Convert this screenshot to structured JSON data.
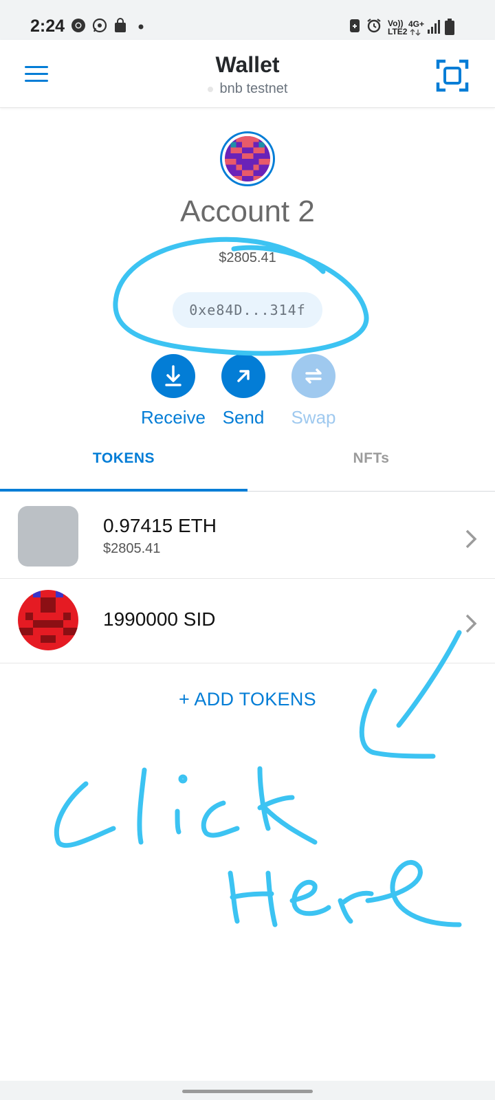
{
  "status_bar": {
    "time": "2:24",
    "icons_left": [
      "chrome-icon",
      "whatsapp-icon",
      "shopping-bag-icon",
      "dot-icon"
    ],
    "volte": "Vo))",
    "lte": "LTE2",
    "network": "4G+",
    "icons_right": [
      "battery-saver-icon",
      "alarm-icon",
      "signal-icon",
      "battery-icon"
    ]
  },
  "header": {
    "title": "Wallet",
    "network": "bnb testnet",
    "menu_icon": "hamburger-menu-icon",
    "scan_icon": "qr-scan-icon"
  },
  "account": {
    "name": "Account 2",
    "balance": "$2805.41",
    "address": "0xe84D...314f"
  },
  "actions": [
    {
      "label": "Receive",
      "icon": "download-arrow-icon",
      "enabled": true
    },
    {
      "label": "Send",
      "icon": "arrow-up-right-icon",
      "enabled": true
    },
    {
      "label": "Swap",
      "icon": "swap-arrows-icon",
      "enabled": false
    }
  ],
  "tabs": [
    {
      "label": "TOKENS",
      "active": true
    },
    {
      "label": "NFTs",
      "active": false
    }
  ],
  "tokens": [
    {
      "amount": "0.97415 ETH",
      "fiat": "$2805.41",
      "icon": "eth-placeholder-icon"
    },
    {
      "amount": "1990000 SID",
      "fiat": "",
      "icon": "sid-pixel-icon"
    }
  ],
  "add_tokens": "+ ADD TOKENS",
  "annotation_text": "Click Here",
  "colors": {
    "accent": "#037dd6",
    "accent_disabled": "#9fc9ef",
    "annotation": "#3cc3f2",
    "address_pill_bg": "#e9f4fd"
  }
}
